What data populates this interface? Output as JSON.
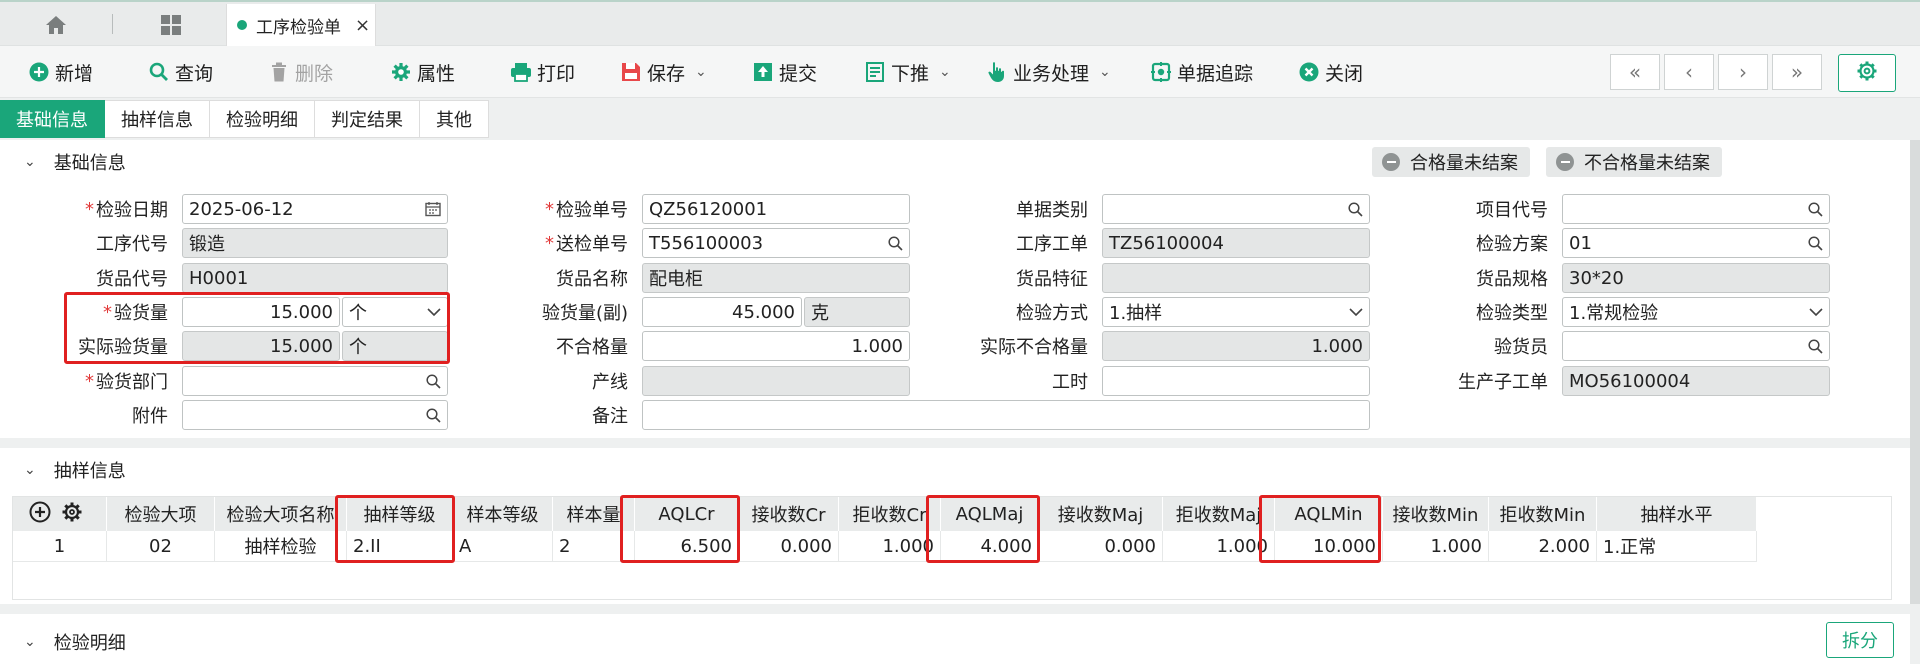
{
  "colors": {
    "accent": "#1aa67a",
    "danger": "#e02020"
  },
  "tabbar": {
    "doc_tab": "工序检验单",
    "close": "×"
  },
  "toolbar": {
    "new": "新增",
    "query": "查询",
    "delete": "删除",
    "props": "属性",
    "print": "打印",
    "save": "保存",
    "submit": "提交",
    "push": "下推",
    "business": "业务处理",
    "track": "单据追踪",
    "close": "关闭"
  },
  "subtabs": [
    "基础信息",
    "抽样信息",
    "检验明细",
    "判定结果",
    "其他"
  ],
  "sections": {
    "basic": "基础信息",
    "sampling": "抽样信息",
    "detail": "检验明细"
  },
  "pills": {
    "ok_unclosed": "合格量未结案",
    "ng_unclosed": "不合格量未结案"
  },
  "form": {
    "insp_date": {
      "label": "检验日期",
      "value": "2025-06-12"
    },
    "process_code": {
      "label": "工序代号",
      "value": "锻造"
    },
    "item_code": {
      "label": "货品代号",
      "value": "H0001"
    },
    "insp_qty": {
      "label": "验货量",
      "value": "15.000",
      "unit": "个"
    },
    "actual_qty": {
      "label": "实际验货量",
      "value": "15.000",
      "unit": "个"
    },
    "insp_dept": {
      "label": "验货部门",
      "value": ""
    },
    "attachment": {
      "label": "附件",
      "value": ""
    },
    "insp_no": {
      "label": "检验单号",
      "value": "QZ56120001"
    },
    "send_no": {
      "label": "送检单号",
      "value": "T556100003"
    },
    "item_name": {
      "label": "货品名称",
      "value": "配电柜"
    },
    "insp_qty2": {
      "label": "验货量(副)",
      "value": "45.000",
      "unit": "克"
    },
    "ng_qty": {
      "label": "不合格量",
      "value": "1.000"
    },
    "line": {
      "label": "产线",
      "value": ""
    },
    "remark": {
      "label": "备注",
      "value": ""
    },
    "doc_type": {
      "label": "单据类别",
      "value": ""
    },
    "process_order": {
      "label": "工序工单",
      "value": "TZ56100004"
    },
    "item_feature": {
      "label": "货品特征",
      "value": ""
    },
    "insp_method": {
      "label": "检验方式",
      "value": "1.抽样"
    },
    "actual_ng": {
      "label": "实际不合格量",
      "value": "1.000"
    },
    "work_hours": {
      "label": "工时",
      "value": ""
    },
    "project_code": {
      "label": "项目代号",
      "value": ""
    },
    "insp_plan": {
      "label": "检验方案",
      "value": "01"
    },
    "item_spec": {
      "label": "货品规格",
      "value": "30*20"
    },
    "insp_type": {
      "label": "检验类型",
      "value": "1.常规检验"
    },
    "inspector": {
      "label": "验货员",
      "value": ""
    },
    "mo": {
      "label": "生产子工单",
      "value": "MO56100004"
    }
  },
  "grid": {
    "headers": [
      "检验大项",
      "检验大项名称",
      "抽样等级",
      "样本等级",
      "样本量",
      "AQLCr",
      "接收数Cr",
      "拒收数Cr",
      "AQLMaj",
      "接收数Maj",
      "拒收数Maj",
      "AQLMin",
      "接收数Min",
      "拒收数Min",
      "抽样水平"
    ],
    "rows": [
      {
        "no": "1",
        "cells": [
          "02",
          "抽样检验",
          "2.II",
          "A",
          "2",
          "6.500",
          "0.000",
          "1.000",
          "4.000",
          "0.000",
          "1.000",
          "10.000",
          "1.000",
          "2.000",
          "1.正常"
        ]
      }
    ]
  },
  "split_button": "拆分"
}
